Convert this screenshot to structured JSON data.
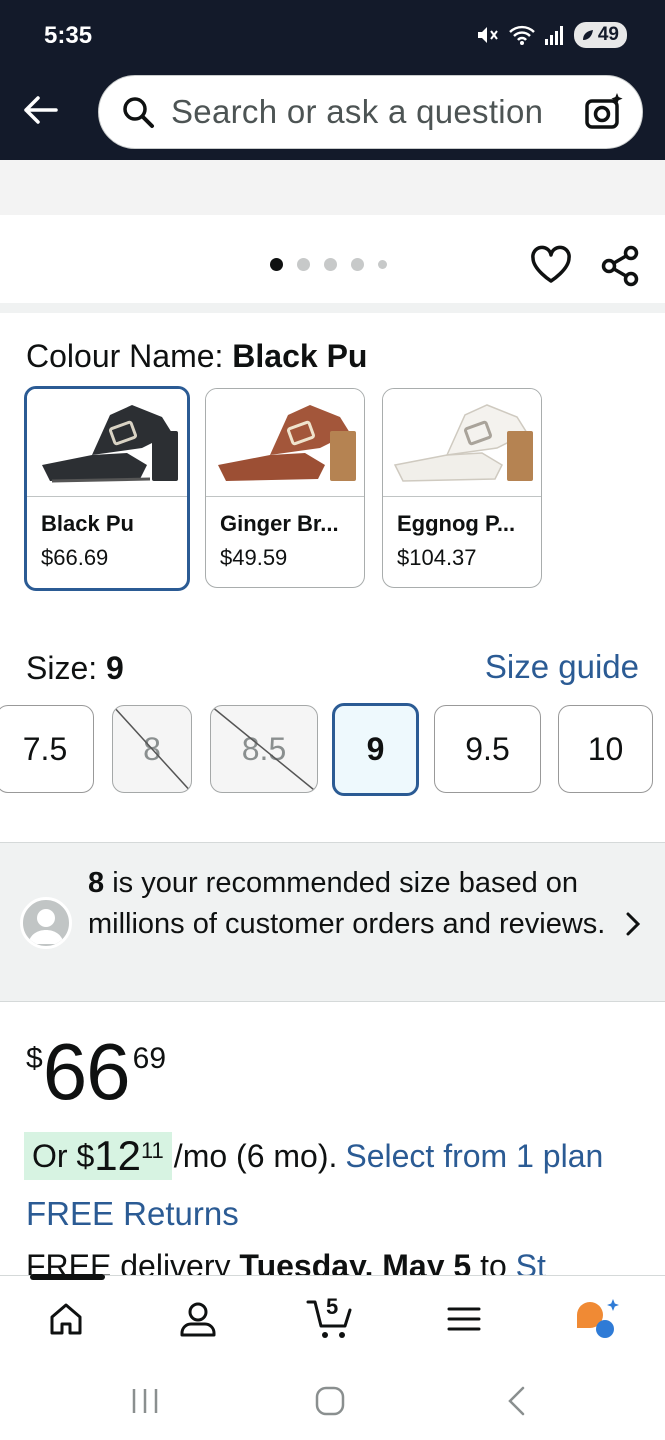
{
  "status": {
    "time": "5:35",
    "battery": "49"
  },
  "search": {
    "placeholder": "Search or ask a question"
  },
  "carousel": {
    "dots": 5,
    "active": 0
  },
  "colour": {
    "label": "Colour Name: ",
    "selected": "Black Pu",
    "options": [
      {
        "name": "Black Pu",
        "price": "$66.69",
        "color": "#2c2f33"
      },
      {
        "name": "Ginger Br...",
        "price": "$49.59",
        "color": "#9c4f34"
      },
      {
        "name": "Eggnog P...",
        "price": "$104.37",
        "color": "#f1efea"
      }
    ]
  },
  "size": {
    "label": "Size: ",
    "selected": "9",
    "guide": "Size guide",
    "options": [
      {
        "label": "7.5",
        "available": true
      },
      {
        "label": "8",
        "available": false
      },
      {
        "label": "8.5",
        "available": false
      },
      {
        "label": "9",
        "available": true,
        "selected": true
      },
      {
        "label": "9.5",
        "available": true
      },
      {
        "label": "10",
        "available": true
      }
    ]
  },
  "recommendation": {
    "size": "8",
    "text": " is your recommended size based on millions of customer orders and reviews."
  },
  "price": {
    "symbol": "$",
    "whole": "66",
    "fraction": "69"
  },
  "plan": {
    "prefix": "Or $",
    "whole": "12",
    "fraction": "11",
    "suffix": "/mo (6 mo).",
    "link": "Select from 1 plan"
  },
  "returns": "FREE Returns",
  "delivery": {
    "prefix": "FREE delivery ",
    "date": "Tuesday, May 5",
    "mid": " to ",
    "link": "St"
  },
  "nav": {
    "cart_count": "5"
  },
  "colors": {
    "accent": "#2b5b94",
    "header": "#131a2a",
    "highlight": "#d7f3e2"
  }
}
